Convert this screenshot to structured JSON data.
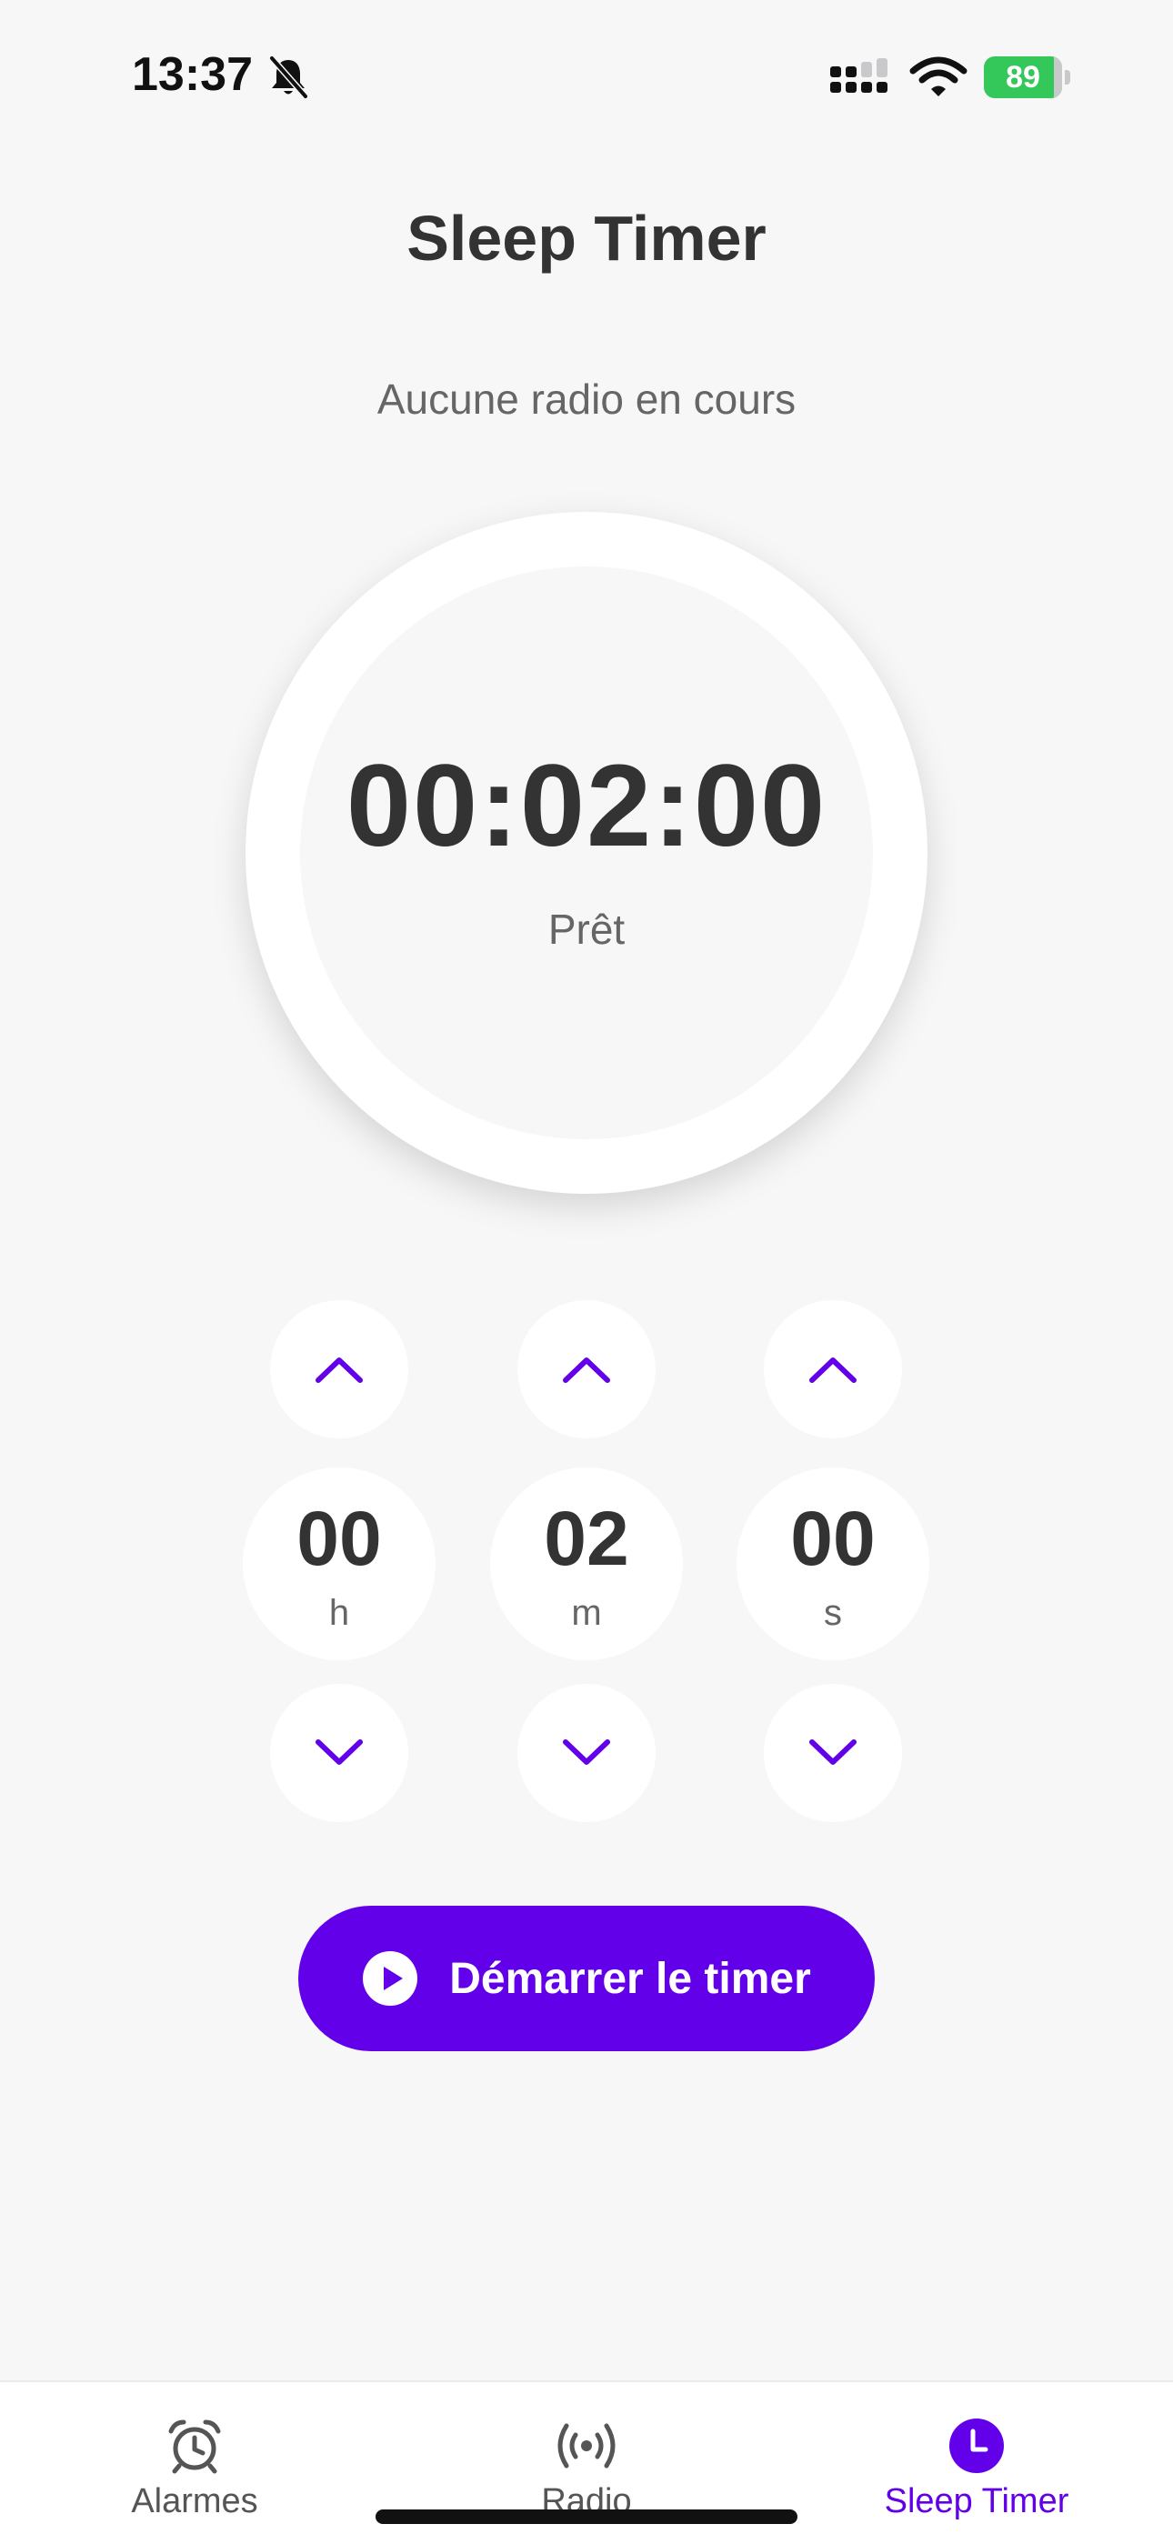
{
  "status_bar": {
    "time": "13:37",
    "battery": "89",
    "battery_level": 0.89,
    "icons": [
      "bell-slash-icon",
      "cellular-signal-icon",
      "wifi-icon",
      "battery-charging-icon"
    ]
  },
  "header": {
    "title": "Sleep Timer",
    "subtitle": "Aucune radio en cours"
  },
  "timer": {
    "display": "00:02:00",
    "status": "Prêt"
  },
  "steppers": [
    {
      "value": "00",
      "unit": "h"
    },
    {
      "value": "02",
      "unit": "m"
    },
    {
      "value": "00",
      "unit": "s"
    }
  ],
  "start_button": {
    "label": "Démarrer le timer",
    "icon": "play-circle-icon"
  },
  "tab_bar": {
    "items": [
      {
        "label": "Alarmes",
        "icon": "alarm-clock-icon",
        "active": false
      },
      {
        "label": "Radio",
        "icon": "radio-broadcast-icon",
        "active": false
      },
      {
        "label": "Sleep Timer",
        "icon": "clock-icon",
        "active": true
      }
    ]
  },
  "colors": {
    "accent": "#6200ea",
    "background": "#f7f7f8",
    "text": "#333333",
    "muted": "#666666",
    "battery": "#34c759"
  }
}
